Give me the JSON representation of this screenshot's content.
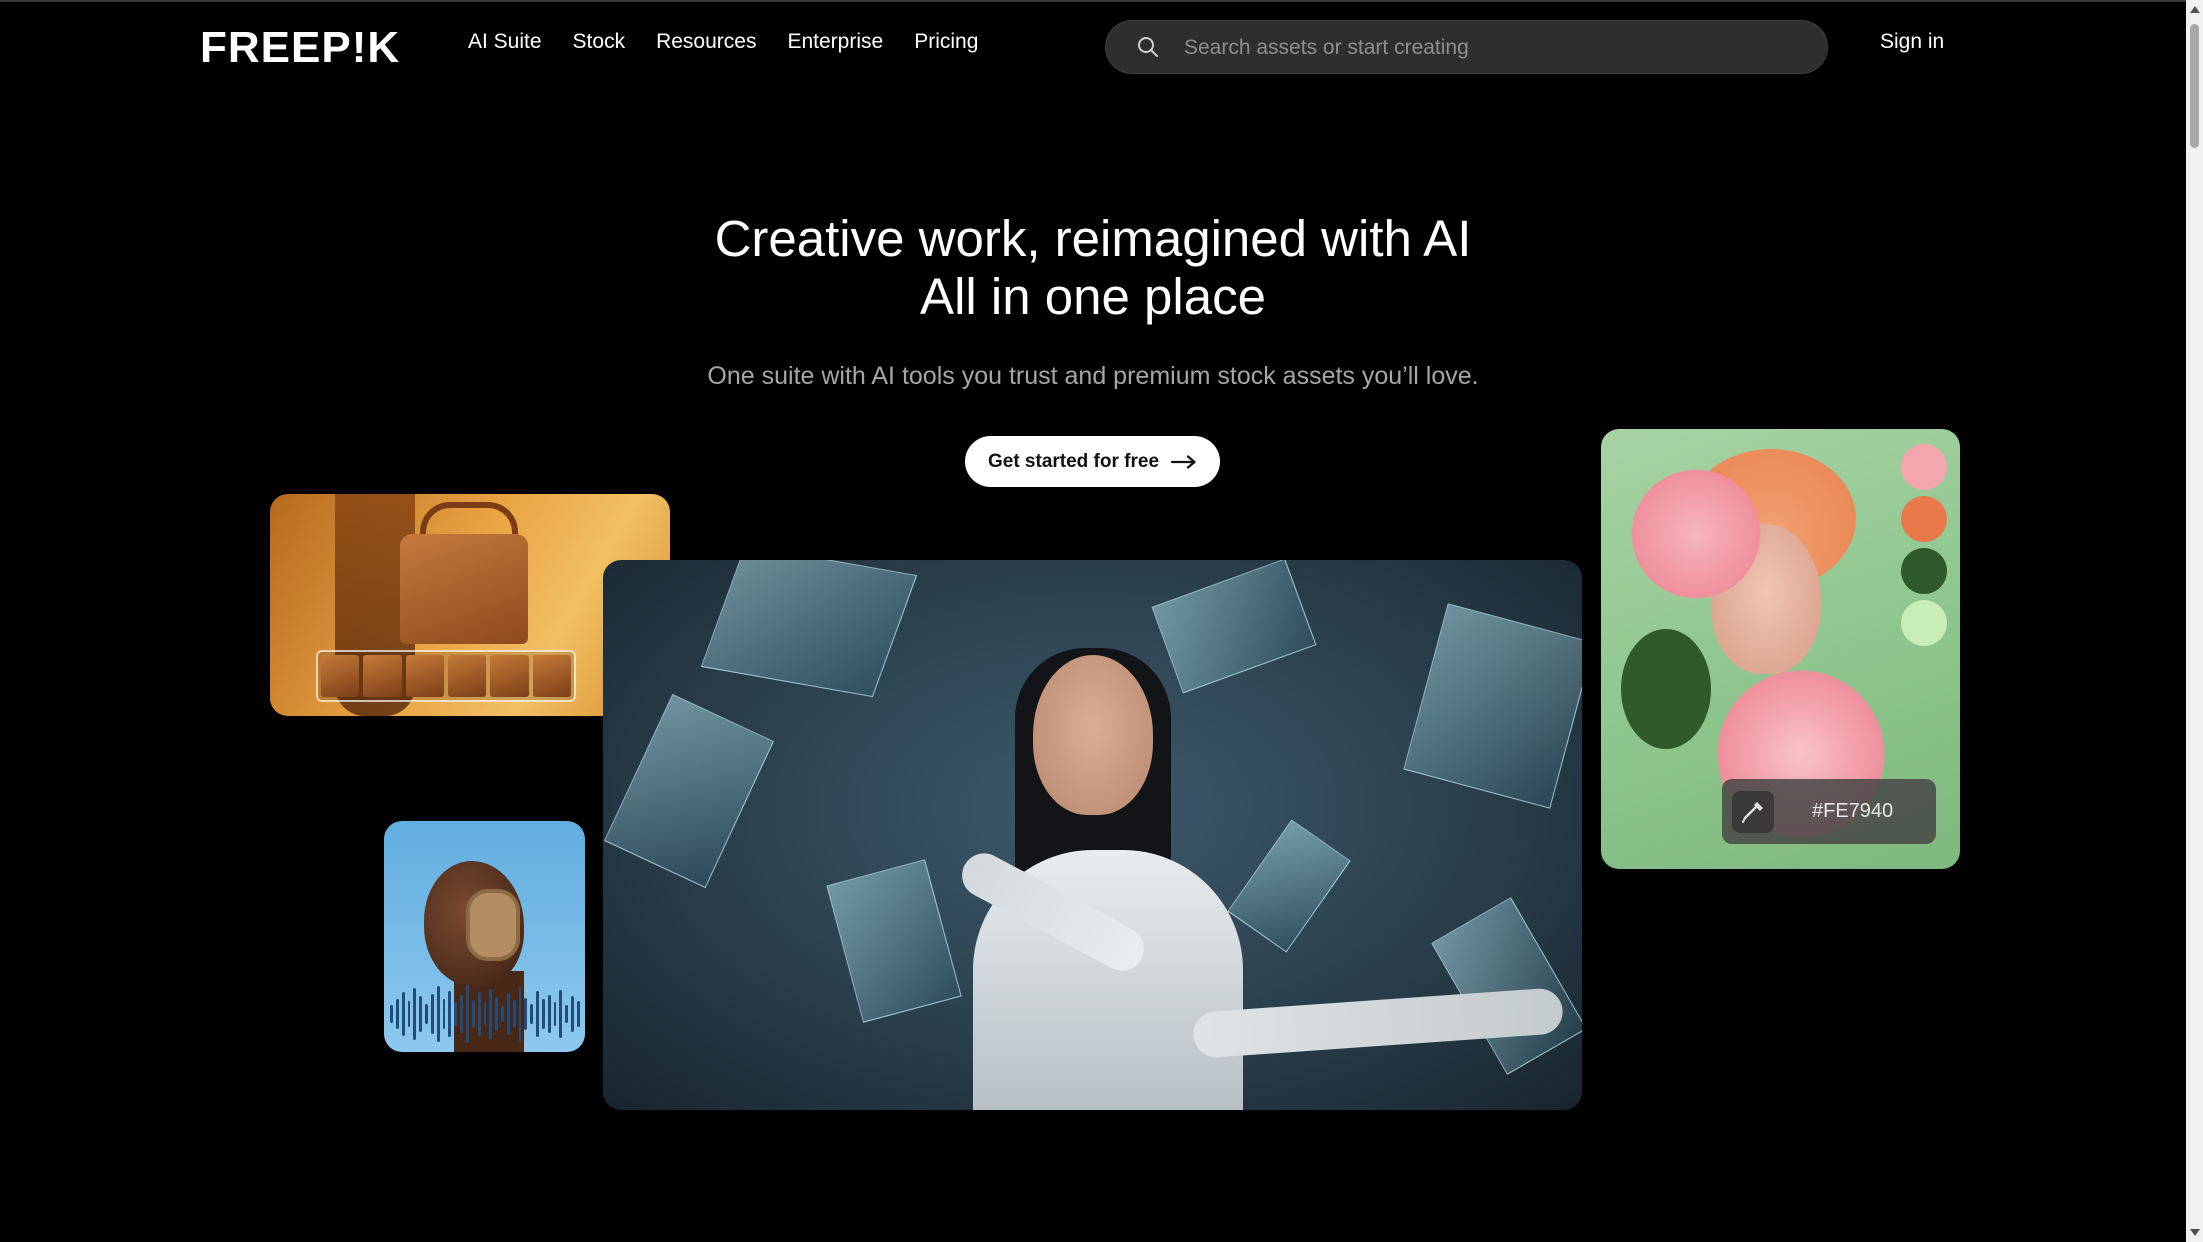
{
  "header": {
    "logo": "FREEP!K",
    "nav": [
      "AI Suite",
      "Stock",
      "Resources",
      "Enterprise",
      "Pricing"
    ],
    "search_placeholder": "Search assets or start creating",
    "signin_label": "Sign in"
  },
  "hero": {
    "title_line1": "Creative work, reimagined with AI",
    "title_line2": "All in one place",
    "subtitle": "One suite with AI tools you trust and premium stock assets you’ll love.",
    "cta_label": "Get started for free"
  },
  "portrait_card": {
    "swatches": [
      "#F4A6AE",
      "#E9784A",
      "#2E5A2B",
      "#C9EDB8"
    ],
    "picked_color": "#FE7940"
  },
  "colors": {
    "background": "#000000",
    "search_bg": "#2E2E2E",
    "cta_bg": "#FFFFFF"
  },
  "icons": [
    "search-icon",
    "arrow-right-icon",
    "eyedropper-icon"
  ]
}
